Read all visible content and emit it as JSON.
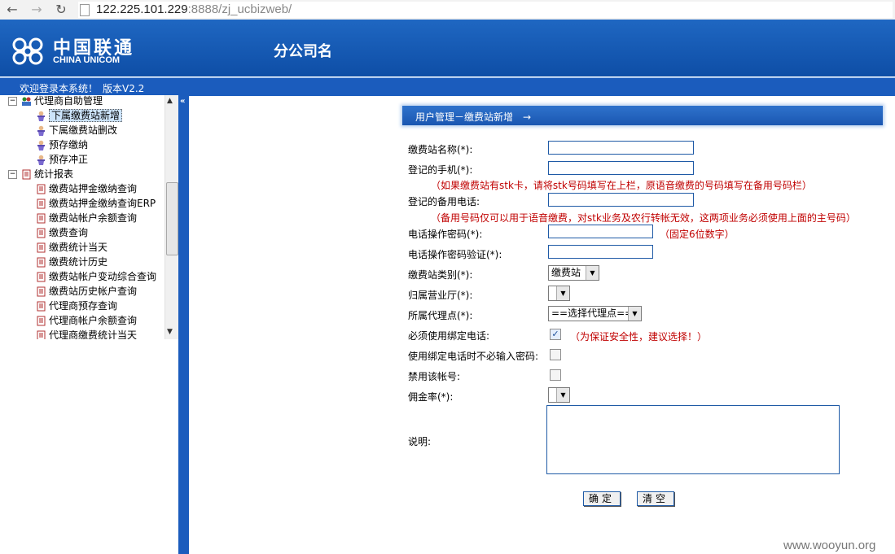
{
  "browser": {
    "url_host": "122.225.101.229",
    "url_rest": ":8888/zj_ucbizweb/"
  },
  "header": {
    "logo_cn": "中国联通",
    "logo_en": "CHINA UNICOM",
    "company_name": "分公司名",
    "welcome_text": "欢迎登录本系统！",
    "version_text": "版本V2.2"
  },
  "sidebar": {
    "group1": {
      "label": "代理商自助管理",
      "items": [
        "下属缴费站新增",
        "下属缴费站删改",
        "预存缴纳",
        "预存冲正"
      ],
      "selected_index": 0
    },
    "group2": {
      "label": "统计报表",
      "items": [
        "缴费站押金缴纳查询",
        "缴费站押金缴纳查询ERP",
        "缴费站帐户余额查询",
        "缴费查询",
        "缴费统计当天",
        "缴费统计历史",
        "缴费站帐户变动综合查询",
        "缴费站历史帐户查询",
        "代理商预存查询",
        "代理商帐户余额查询",
        "代理商缴费统计当天"
      ]
    }
  },
  "form": {
    "title": "用户管理－缴费站新增　→",
    "station_name_label": "缴费站名称(*):",
    "station_name_value": "",
    "phone_label": "登记的手机(*):",
    "phone_value": "",
    "phone_hint": "（如果缴费站有stk卡，请将stk号码填写在上栏，原语音缴费的号码填写在备用号码栏）",
    "backup_phone_label": "登记的备用电话:",
    "backup_phone_value": "",
    "backup_phone_hint": "（备用号码仅可以用于语音缴费，对stk业务及农行转帐无效，这两项业务必须使用上面的主号码）",
    "phone_pwd_label": "电话操作密码(*):",
    "phone_pwd_value": "",
    "phone_pwd_hint": "（固定6位数字）",
    "phone_pwd_confirm_label": "电话操作密码验证(*):",
    "phone_pwd_confirm_value": "",
    "station_type_label": "缴费站类别(*):",
    "station_type_value": "缴费站",
    "hall_label": "归属营业厅(*):",
    "hall_value": "",
    "agent_point_label": "所属代理点(*):",
    "agent_point_value": "==选择代理点==",
    "bind_phone_label": "必须使用绑定电话:",
    "bind_phone_checked": true,
    "bind_phone_hint": "（为保证安全性，建议选择！）",
    "no_pwd_label": "使用绑定电话时不必输入密码:",
    "no_pwd_checked": false,
    "disable_label": "禁用该帐号:",
    "disable_checked": false,
    "commission_label": "佣金率(*):",
    "commission_value": "",
    "remark_label": "说明:",
    "remark_value": "",
    "confirm_label": "确定",
    "clear_label": "清空"
  },
  "watermark": "www.wooyun.org",
  "colors": {
    "header_blue": "#1f67c2",
    "hint_red": "#c00000"
  }
}
